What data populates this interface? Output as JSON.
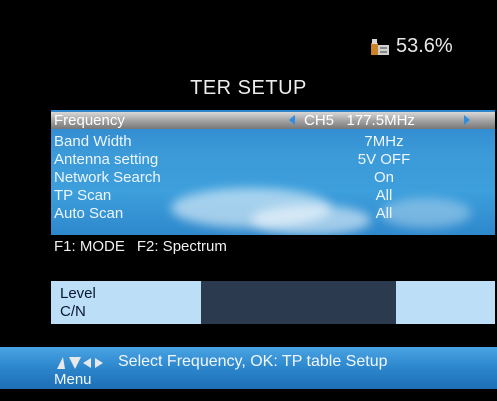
{
  "storage": {
    "icon": "usb-storage-icon",
    "percent": "53.6%"
  },
  "title": "TER SETUP",
  "menu": {
    "frequency": {
      "label": "Frequency",
      "channel": "CH5",
      "value": "177.5MHz"
    },
    "rows": [
      {
        "label": "Band Width",
        "value": "7MHz"
      },
      {
        "label": "Antenna setting",
        "value": "5V OFF"
      },
      {
        "label": "Network Search",
        "value": "On"
      },
      {
        "label": "TP Scan",
        "value": "All"
      },
      {
        "label": "Auto Scan",
        "value": "All"
      }
    ]
  },
  "function_keys": {
    "f1": "F1: MODE",
    "f2": "F2: Spectrum"
  },
  "signal": {
    "level_label": "Level",
    "cn_label": "C/N",
    "level_value": 0,
    "cn_value": 0
  },
  "status_bar": {
    "nav_icon": "navigation-arrows-icon",
    "hint": "Select Frequency, OK: TP table Setup",
    "hint_line2": "Menu"
  },
  "colors": {
    "background": "#000000",
    "menu_blue": "#3c9ad8",
    "selected_row": "#a9a9a9",
    "arrow": "#2e8ee0",
    "signal_label_bg": "#bcdff7",
    "signal_track": "#2b3a4e",
    "status_bar": "#2c86cc"
  }
}
